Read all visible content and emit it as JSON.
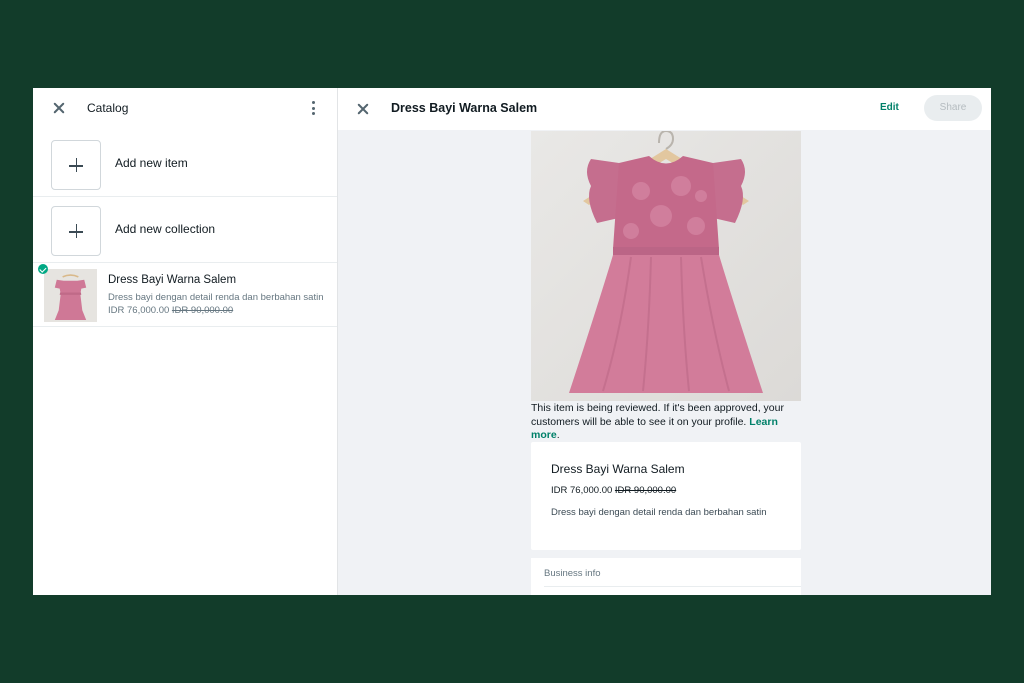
{
  "catalog_panel": {
    "title": "Catalog",
    "add_item_label": "Add new item",
    "add_collection_label": "Add new collection",
    "items": [
      {
        "title": "Dress Bayi Warna Salem",
        "description": "Dress bayi dengan detail renda dan berbahan satin",
        "price": "IDR 76,000.00",
        "original_price": "IDR 90,000.00",
        "status_icon": "check-icon"
      }
    ]
  },
  "product_panel": {
    "title": "Dress Bayi Warna Salem",
    "edit_label": "Edit",
    "share_label": "Share",
    "review_note": "This item is being reviewed. If it's been approved, your customers will be able to see it on your profile.",
    "learn_more": "Learn more",
    "product": {
      "name": "Dress Bayi Warna Salem",
      "price": "IDR 76,000.00",
      "original_price": "IDR 90,000.00",
      "description": "Dress bayi dengan detail renda dan berbahan satin"
    },
    "business_info_label": "Business info"
  },
  "colors": {
    "background": "#123c2a",
    "accent": "#008069",
    "badge": "#00a884",
    "dress": "#cf7896"
  }
}
